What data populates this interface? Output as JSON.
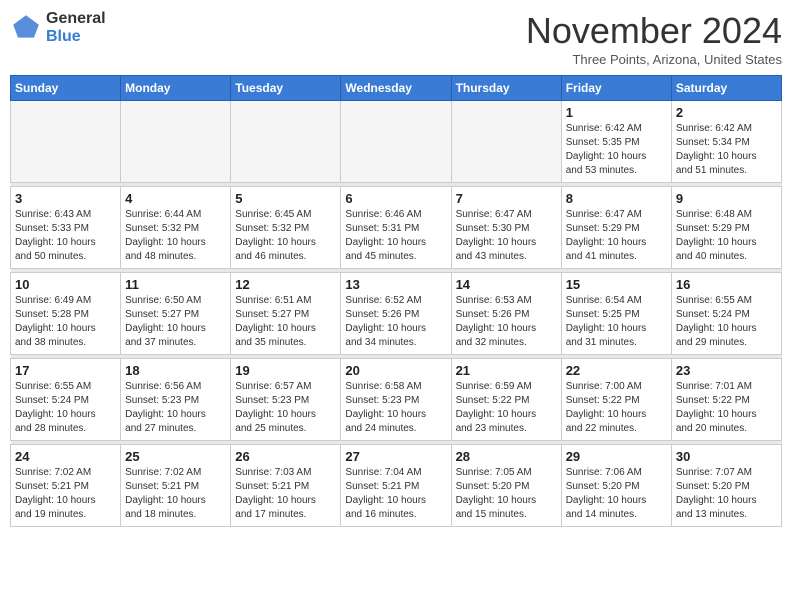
{
  "logo": {
    "general": "General",
    "blue": "Blue"
  },
  "title": "November 2024",
  "location": "Three Points, Arizona, United States",
  "weekdays": [
    "Sunday",
    "Monday",
    "Tuesday",
    "Wednesday",
    "Thursday",
    "Friday",
    "Saturday"
  ],
  "weeks": [
    [
      {
        "day": "",
        "info": ""
      },
      {
        "day": "",
        "info": ""
      },
      {
        "day": "",
        "info": ""
      },
      {
        "day": "",
        "info": ""
      },
      {
        "day": "",
        "info": ""
      },
      {
        "day": "1",
        "info": "Sunrise: 6:42 AM\nSunset: 5:35 PM\nDaylight: 10 hours\nand 53 minutes."
      },
      {
        "day": "2",
        "info": "Sunrise: 6:42 AM\nSunset: 5:34 PM\nDaylight: 10 hours\nand 51 minutes."
      }
    ],
    [
      {
        "day": "3",
        "info": "Sunrise: 6:43 AM\nSunset: 5:33 PM\nDaylight: 10 hours\nand 50 minutes."
      },
      {
        "day": "4",
        "info": "Sunrise: 6:44 AM\nSunset: 5:32 PM\nDaylight: 10 hours\nand 48 minutes."
      },
      {
        "day": "5",
        "info": "Sunrise: 6:45 AM\nSunset: 5:32 PM\nDaylight: 10 hours\nand 46 minutes."
      },
      {
        "day": "6",
        "info": "Sunrise: 6:46 AM\nSunset: 5:31 PM\nDaylight: 10 hours\nand 45 minutes."
      },
      {
        "day": "7",
        "info": "Sunrise: 6:47 AM\nSunset: 5:30 PM\nDaylight: 10 hours\nand 43 minutes."
      },
      {
        "day": "8",
        "info": "Sunrise: 6:47 AM\nSunset: 5:29 PM\nDaylight: 10 hours\nand 41 minutes."
      },
      {
        "day": "9",
        "info": "Sunrise: 6:48 AM\nSunset: 5:29 PM\nDaylight: 10 hours\nand 40 minutes."
      }
    ],
    [
      {
        "day": "10",
        "info": "Sunrise: 6:49 AM\nSunset: 5:28 PM\nDaylight: 10 hours\nand 38 minutes."
      },
      {
        "day": "11",
        "info": "Sunrise: 6:50 AM\nSunset: 5:27 PM\nDaylight: 10 hours\nand 37 minutes."
      },
      {
        "day": "12",
        "info": "Sunrise: 6:51 AM\nSunset: 5:27 PM\nDaylight: 10 hours\nand 35 minutes."
      },
      {
        "day": "13",
        "info": "Sunrise: 6:52 AM\nSunset: 5:26 PM\nDaylight: 10 hours\nand 34 minutes."
      },
      {
        "day": "14",
        "info": "Sunrise: 6:53 AM\nSunset: 5:26 PM\nDaylight: 10 hours\nand 32 minutes."
      },
      {
        "day": "15",
        "info": "Sunrise: 6:54 AM\nSunset: 5:25 PM\nDaylight: 10 hours\nand 31 minutes."
      },
      {
        "day": "16",
        "info": "Sunrise: 6:55 AM\nSunset: 5:24 PM\nDaylight: 10 hours\nand 29 minutes."
      }
    ],
    [
      {
        "day": "17",
        "info": "Sunrise: 6:55 AM\nSunset: 5:24 PM\nDaylight: 10 hours\nand 28 minutes."
      },
      {
        "day": "18",
        "info": "Sunrise: 6:56 AM\nSunset: 5:23 PM\nDaylight: 10 hours\nand 27 minutes."
      },
      {
        "day": "19",
        "info": "Sunrise: 6:57 AM\nSunset: 5:23 PM\nDaylight: 10 hours\nand 25 minutes."
      },
      {
        "day": "20",
        "info": "Sunrise: 6:58 AM\nSunset: 5:23 PM\nDaylight: 10 hours\nand 24 minutes."
      },
      {
        "day": "21",
        "info": "Sunrise: 6:59 AM\nSunset: 5:22 PM\nDaylight: 10 hours\nand 23 minutes."
      },
      {
        "day": "22",
        "info": "Sunrise: 7:00 AM\nSunset: 5:22 PM\nDaylight: 10 hours\nand 22 minutes."
      },
      {
        "day": "23",
        "info": "Sunrise: 7:01 AM\nSunset: 5:22 PM\nDaylight: 10 hours\nand 20 minutes."
      }
    ],
    [
      {
        "day": "24",
        "info": "Sunrise: 7:02 AM\nSunset: 5:21 PM\nDaylight: 10 hours\nand 19 minutes."
      },
      {
        "day": "25",
        "info": "Sunrise: 7:02 AM\nSunset: 5:21 PM\nDaylight: 10 hours\nand 18 minutes."
      },
      {
        "day": "26",
        "info": "Sunrise: 7:03 AM\nSunset: 5:21 PM\nDaylight: 10 hours\nand 17 minutes."
      },
      {
        "day": "27",
        "info": "Sunrise: 7:04 AM\nSunset: 5:21 PM\nDaylight: 10 hours\nand 16 minutes."
      },
      {
        "day": "28",
        "info": "Sunrise: 7:05 AM\nSunset: 5:20 PM\nDaylight: 10 hours\nand 15 minutes."
      },
      {
        "day": "29",
        "info": "Sunrise: 7:06 AM\nSunset: 5:20 PM\nDaylight: 10 hours\nand 14 minutes."
      },
      {
        "day": "30",
        "info": "Sunrise: 7:07 AM\nSunset: 5:20 PM\nDaylight: 10 hours\nand 13 minutes."
      }
    ]
  ]
}
